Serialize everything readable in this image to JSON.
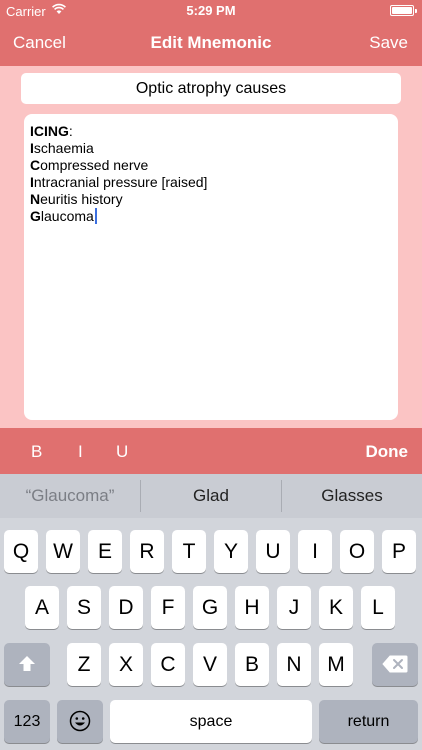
{
  "status_bar": {
    "carrier": "Carrier",
    "time": "5:29 PM"
  },
  "nav": {
    "cancel": "Cancel",
    "title": "Edit Mnemonic",
    "save": "Save"
  },
  "editor": {
    "title": "Optic atrophy causes",
    "body_header": {
      "bold": "ICING",
      "rest": ":"
    },
    "body_lines": [
      {
        "bold": "I",
        "rest": "schaemia"
      },
      {
        "bold": "C",
        "rest": "ompressed nerve"
      },
      {
        "bold": "I",
        "rest": "ntracranial pressure [raised]"
      },
      {
        "bold": "N",
        "rest": "euritis history"
      },
      {
        "bold": "G",
        "rest": "laucoma"
      }
    ]
  },
  "format_bar": {
    "bold": "B",
    "italic": "I",
    "underline": "U",
    "done": "Done"
  },
  "keyboard": {
    "suggestions": [
      "“Glaucoma”",
      "Glad",
      "Glasses"
    ],
    "row1": [
      "Q",
      "W",
      "E",
      "R",
      "T",
      "Y",
      "U",
      "I",
      "O",
      "P"
    ],
    "row2": [
      "A",
      "S",
      "D",
      "F",
      "G",
      "H",
      "J",
      "K",
      "L"
    ],
    "row3": [
      "Z",
      "X",
      "C",
      "V",
      "B",
      "N",
      "M"
    ],
    "numbers_key": "123",
    "space_key": "space",
    "return_key": "return",
    "icons": {
      "shift": "shift-icon",
      "delete": "backspace-icon",
      "emoji": "emoji-icon",
      "wifi": "wifi-icon",
      "battery": "battery-icon"
    }
  },
  "colors": {
    "accent": "#e0706f",
    "background": "#fbc4c4",
    "keyboard": "#d2d5db",
    "caret": "#3b6fe0"
  }
}
